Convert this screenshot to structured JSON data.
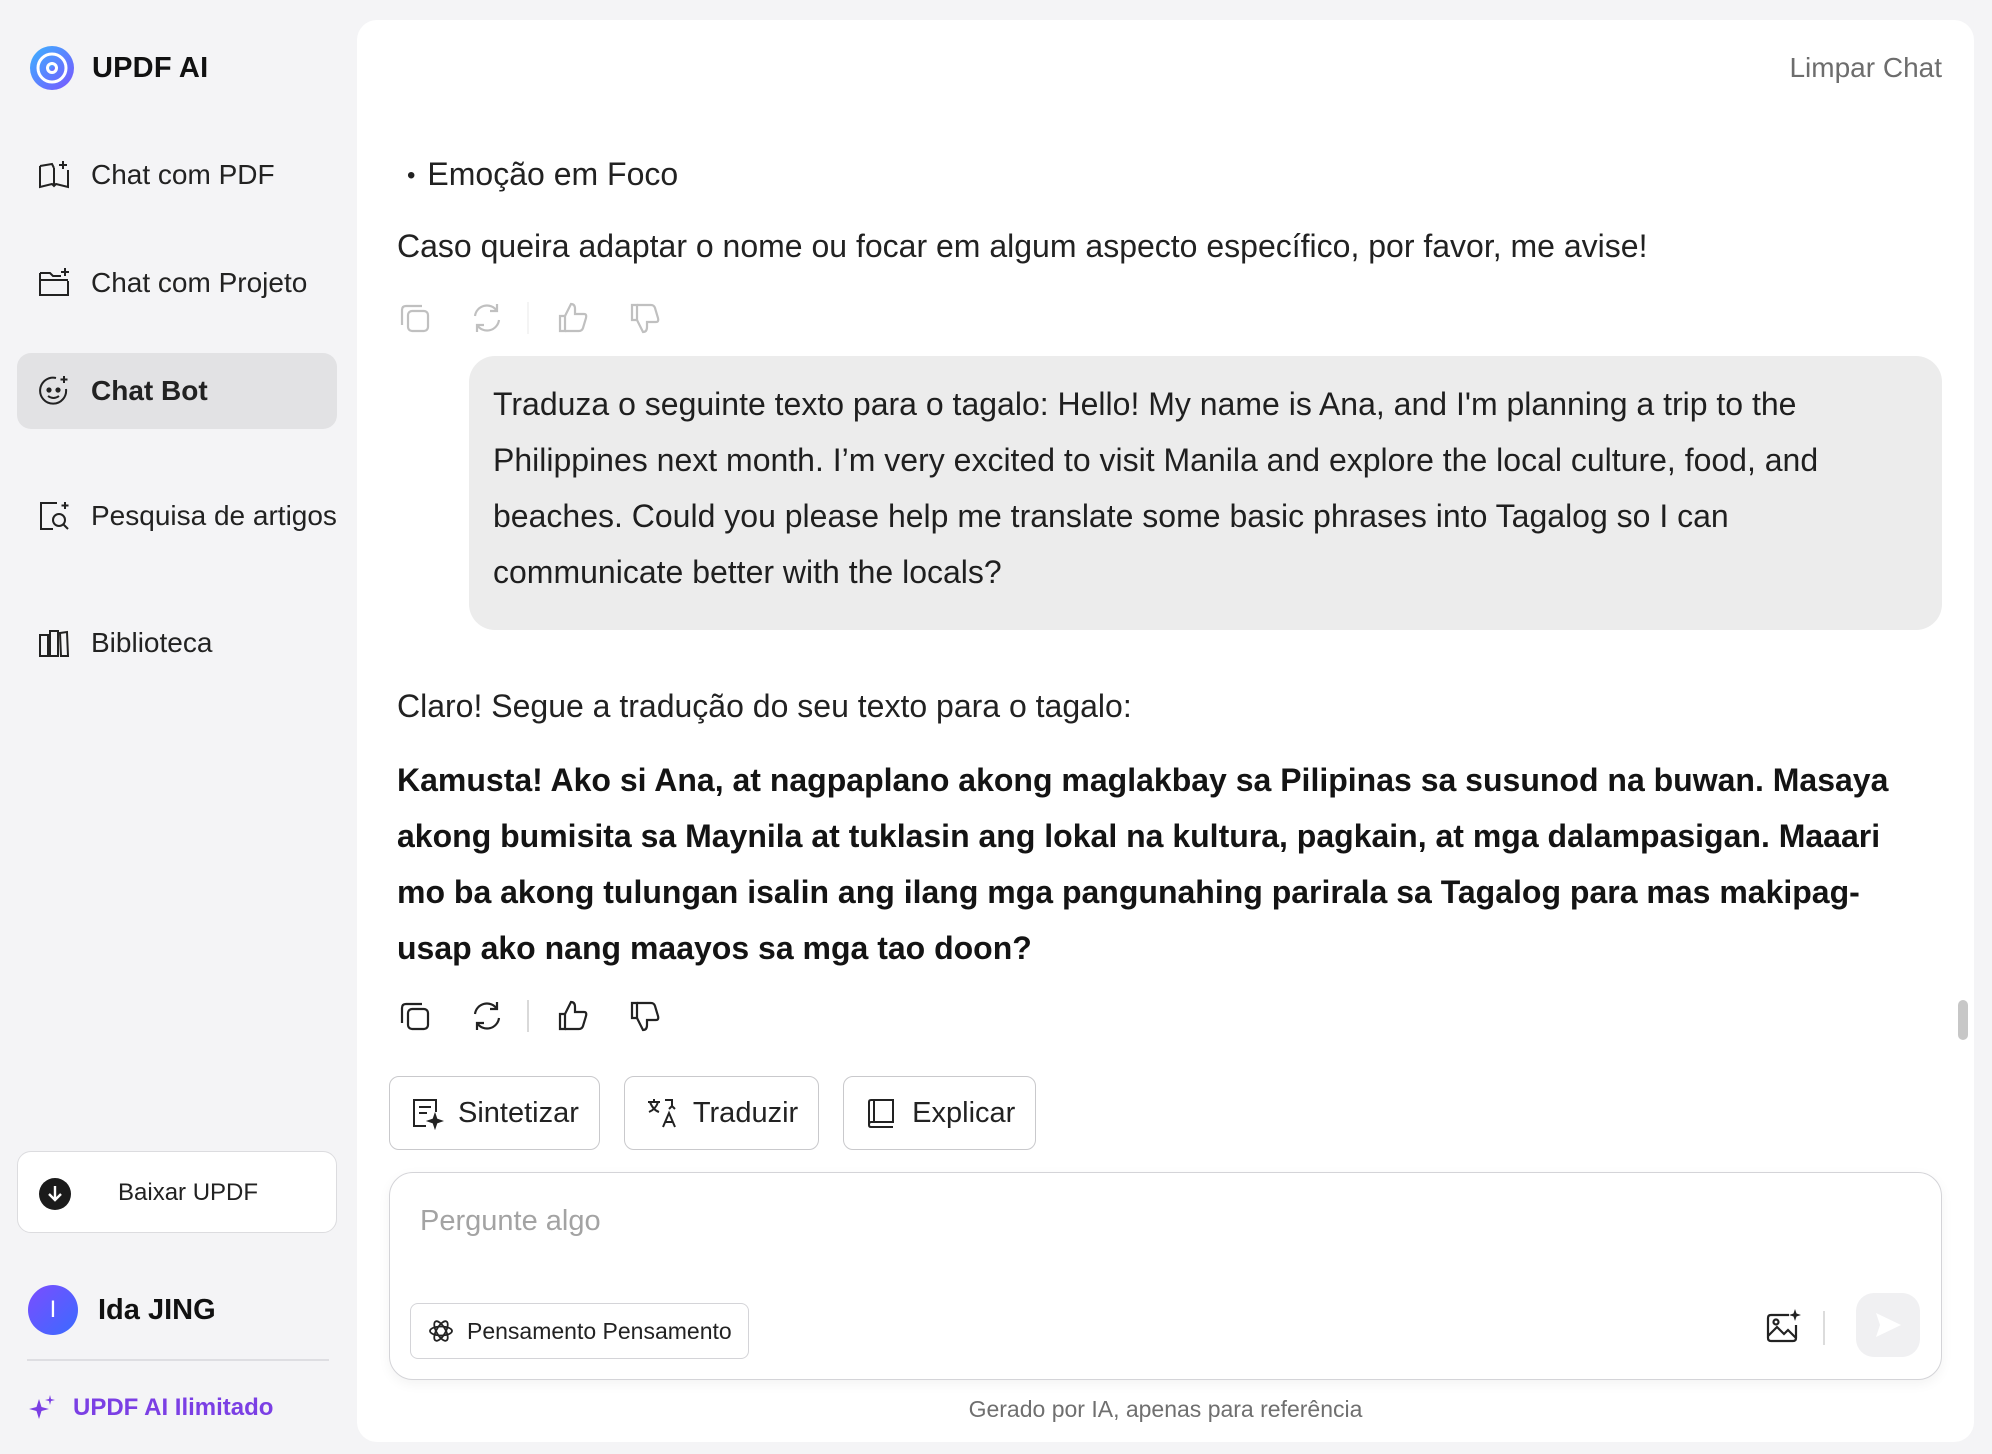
{
  "app": {
    "name": "UPDF AI"
  },
  "sidebar": {
    "items": [
      {
        "label": "Chat com PDF",
        "icon": "book-chat-icon",
        "active": false
      },
      {
        "label": "Chat com Projeto",
        "icon": "folder-chat-icon",
        "active": false
      },
      {
        "label": "Chat Bot",
        "icon": "chatbot-icon",
        "active": true
      },
      {
        "label": "Pesquisa de artigos",
        "icon": "article-search-icon",
        "active": false
      },
      {
        "label": "Biblioteca",
        "icon": "library-icon",
        "active": false
      }
    ],
    "download_label": "Baixar UPDF",
    "user": {
      "initial": "I",
      "name": "Ida JING"
    },
    "unlimited_label": "UPDF AI Ilimitado"
  },
  "header": {
    "clear_chat": "Limpar Chat"
  },
  "messages": {
    "prev_bullet": "Emoção em Foco",
    "prev_closing": "Caso queira adaptar o nome ou focar em algum aspecto específico, por favor, me avise!",
    "user_message": "Traduza o seguinte texto para o tagalo: Hello! My name is Ana, and I'm planning a trip to the Philippines next month. I’m very excited to visit Manila and explore the local culture, food, and beaches. Could you please help me translate some basic phrases into Tagalog so I can communicate better with the locals?",
    "answer_intro": "Claro! Segue a tradução do seu texto para o tagalo:",
    "answer_bold": "Kamusta! Ako si Ana, at nagpaplano akong maglakbay sa Pilipinas sa susunod na buwan. Masaya akong bumisita sa Maynila at tuklasin ang lokal na kultura, pagkain, at mga dalampasigan. Maaari mo ba akong tulungan isalin ang ilang mga pangunahing parirala sa Tagalog para mas makipag-usap ako nang maayos sa mga tao doon?"
  },
  "quick_actions": [
    {
      "label": "Sintetizar",
      "icon": "summarize-icon"
    },
    {
      "label": "Traduzir",
      "icon": "translate-icon"
    },
    {
      "label": "Explicar",
      "icon": "book-icon"
    }
  ],
  "composer": {
    "placeholder": "Pergunte algo",
    "value": "",
    "thinking_label": "Pensamento Pensamento"
  },
  "footer": {
    "disclaimer": "Gerado por IA, apenas para referência"
  },
  "colors": {
    "accent": "#7b3fe4",
    "active_bg": "#e2e2e4",
    "bubble_bg": "#ececec"
  }
}
